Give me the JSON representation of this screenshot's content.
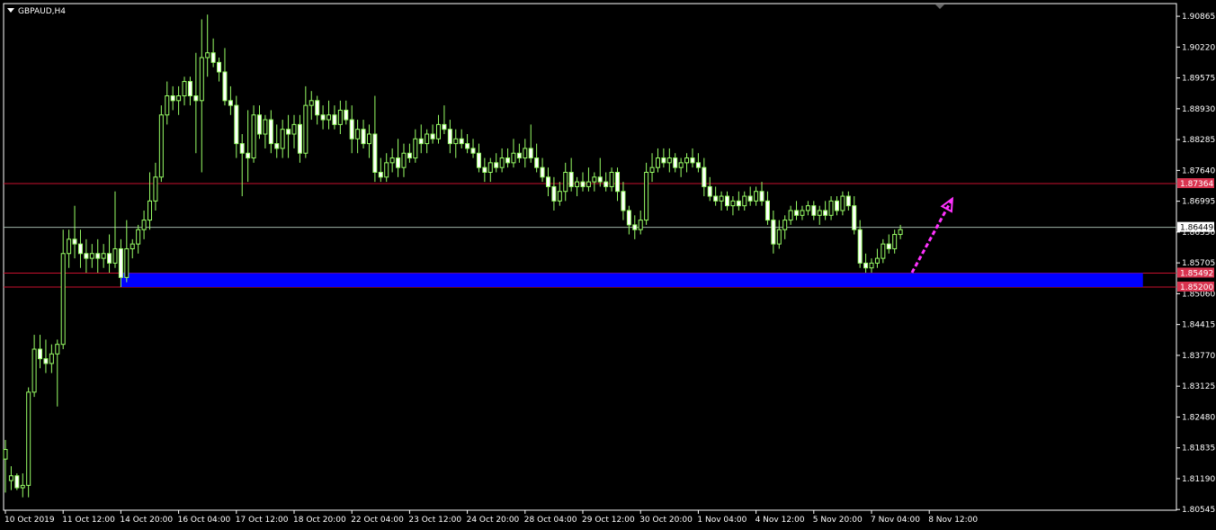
{
  "symbol_label": "GBPAUD,H4",
  "colors": {
    "background": "#000000",
    "frame": "#ffffff",
    "candle": "#99ff66",
    "candle_body_up": "#000000",
    "candle_body_down": "#ffffff",
    "resistance_line": "#c8102e",
    "current_price_line": "#a0b4a8",
    "support_zone": "#0000ff",
    "arrow": "#ff33ff",
    "label_red_bg": "#d9334f",
    "label_white_bg": "#ffffff"
  },
  "chart_data": {
    "type": "candlestick",
    "ylim": [
      1.8053,
      1.9113
    ],
    "y_ticks": [
      "1.90865",
      "1.90220",
      "1.89575",
      "1.88930",
      "1.88285",
      "1.87640",
      "1.86995",
      "1.86350",
      "1.85705",
      "1.85060",
      "1.84415",
      "1.83770",
      "1.83125",
      "1.82480",
      "1.81835",
      "1.81190",
      "1.80545"
    ],
    "x_ticks": [
      "10 Oct 2019",
      "11 Oct 12:00",
      "14 Oct 20:00",
      "16 Oct 04:00",
      "17 Oct 12:00",
      "18 Oct 20:00",
      "22 Oct 04:00",
      "23 Oct 12:00",
      "24 Oct 20:00",
      "28 Oct 04:00",
      "29 Oct 12:00",
      "30 Oct 20:00",
      "1 Nov 04:00",
      "4 Nov 12:00",
      "5 Nov 20:00",
      "7 Nov 04:00",
      "8 Nov 12:00"
    ],
    "x_tick_candle_index": [
      0,
      10,
      20,
      30,
      40,
      50,
      60,
      70,
      80,
      90,
      100,
      110,
      120,
      130,
      140,
      150,
      160
    ],
    "horizontal_lines": [
      {
        "label": "1.87364",
        "price": 1.87364,
        "style": "resistance"
      },
      {
        "label": "1.86449",
        "price": 1.86449,
        "style": "current"
      },
      {
        "label": "1.85492",
        "price": 1.85492,
        "style": "resistance"
      },
      {
        "label": "1.85200",
        "price": 1.852,
        "style": "resistance"
      }
    ],
    "support_zone": {
      "from_price": 1.85492,
      "to_price": 1.852,
      "from_candle": 20,
      "to_candle": 197
    },
    "arrow": {
      "from_candle": 157,
      "from_price": 1.855,
      "to_candle": 164,
      "to_price": 1.8705
    },
    "candles": [
      {
        "o": 1.816,
        "h": 1.82,
        "l": 1.809,
        "c": 1.818
      },
      {
        "o": 1.8115,
        "h": 1.8145,
        "l": 1.8095,
        "c": 1.8125
      },
      {
        "o": 1.8125,
        "h": 1.813,
        "l": 1.8095,
        "c": 1.81
      },
      {
        "o": 1.81,
        "h": 1.813,
        "l": 1.808,
        "c": 1.8105
      },
      {
        "o": 1.8105,
        "h": 1.831,
        "l": 1.808,
        "c": 1.83
      },
      {
        "o": 1.83,
        "h": 1.842,
        "l": 1.829,
        "c": 1.839
      },
      {
        "o": 1.839,
        "h": 1.842,
        "l": 1.835,
        "c": 1.837
      },
      {
        "o": 1.837,
        "h": 1.841,
        "l": 1.834,
        "c": 1.836
      },
      {
        "o": 1.836,
        "h": 1.84,
        "l": 1.834,
        "c": 1.838
      },
      {
        "o": 1.838,
        "h": 1.841,
        "l": 1.827,
        "c": 1.84
      },
      {
        "o": 1.84,
        "h": 1.864,
        "l": 1.839,
        "c": 1.859
      },
      {
        "o": 1.859,
        "h": 1.864,
        "l": 1.856,
        "c": 1.862
      },
      {
        "o": 1.862,
        "h": 1.869,
        "l": 1.858,
        "c": 1.861
      },
      {
        "o": 1.861,
        "h": 1.864,
        "l": 1.856,
        "c": 1.859
      },
      {
        "o": 1.859,
        "h": 1.862,
        "l": 1.855,
        "c": 1.858
      },
      {
        "o": 1.858,
        "h": 1.861,
        "l": 1.856,
        "c": 1.859
      },
      {
        "o": 1.859,
        "h": 1.862,
        "l": 1.855,
        "c": 1.858
      },
      {
        "o": 1.858,
        "h": 1.861,
        "l": 1.856,
        "c": 1.859
      },
      {
        "o": 1.859,
        "h": 1.863,
        "l": 1.855,
        "c": 1.857
      },
      {
        "o": 1.857,
        "h": 1.872,
        "l": 1.856,
        "c": 1.86
      },
      {
        "o": 1.86,
        "h": 1.862,
        "l": 1.852,
        "c": 1.854
      },
      {
        "o": 1.854,
        "h": 1.866,
        "l": 1.853,
        "c": 1.86
      },
      {
        "o": 1.86,
        "h": 1.862,
        "l": 1.858,
        "c": 1.861
      },
      {
        "o": 1.861,
        "h": 1.865,
        "l": 1.859,
        "c": 1.864
      },
      {
        "o": 1.864,
        "h": 1.868,
        "l": 1.862,
        "c": 1.866
      },
      {
        "o": 1.866,
        "h": 1.876,
        "l": 1.864,
        "c": 1.87
      },
      {
        "o": 1.87,
        "h": 1.878,
        "l": 1.868,
        "c": 1.875
      },
      {
        "o": 1.875,
        "h": 1.89,
        "l": 1.874,
        "c": 1.888
      },
      {
        "o": 1.888,
        "h": 1.895,
        "l": 1.886,
        "c": 1.892
      },
      {
        "o": 1.892,
        "h": 1.894,
        "l": 1.889,
        "c": 1.891
      },
      {
        "o": 1.891,
        "h": 1.894,
        "l": 1.888,
        "c": 1.892
      },
      {
        "o": 1.892,
        "h": 1.896,
        "l": 1.89,
        "c": 1.895
      },
      {
        "o": 1.895,
        "h": 1.896,
        "l": 1.89,
        "c": 1.892
      },
      {
        "o": 1.892,
        "h": 1.901,
        "l": 1.88,
        "c": 1.891
      },
      {
        "o": 1.891,
        "h": 1.908,
        "l": 1.876,
        "c": 1.9
      },
      {
        "o": 1.9,
        "h": 1.909,
        "l": 1.896,
        "c": 1.901
      },
      {
        "o": 1.901,
        "h": 1.904,
        "l": 1.898,
        "c": 1.899
      },
      {
        "o": 1.899,
        "h": 1.9,
        "l": 1.895,
        "c": 1.897
      },
      {
        "o": 1.897,
        "h": 1.902,
        "l": 1.89,
        "c": 1.891
      },
      {
        "o": 1.891,
        "h": 1.894,
        "l": 1.888,
        "c": 1.89
      },
      {
        "o": 1.89,
        "h": 1.892,
        "l": 1.879,
        "c": 1.882
      },
      {
        "o": 1.882,
        "h": 1.884,
        "l": 1.871,
        "c": 1.88
      },
      {
        "o": 1.88,
        "h": 1.889,
        "l": 1.874,
        "c": 1.879
      },
      {
        "o": 1.879,
        "h": 1.89,
        "l": 1.878,
        "c": 1.888
      },
      {
        "o": 1.888,
        "h": 1.89,
        "l": 1.883,
        "c": 1.884
      },
      {
        "o": 1.884,
        "h": 1.888,
        "l": 1.881,
        "c": 1.887
      },
      {
        "o": 1.887,
        "h": 1.889,
        "l": 1.88,
        "c": 1.882
      },
      {
        "o": 1.882,
        "h": 1.886,
        "l": 1.879,
        "c": 1.881
      },
      {
        "o": 1.881,
        "h": 1.887,
        "l": 1.879,
        "c": 1.885
      },
      {
        "o": 1.885,
        "h": 1.888,
        "l": 1.879,
        "c": 1.884
      },
      {
        "o": 1.884,
        "h": 1.888,
        "l": 1.881,
        "c": 1.886
      },
      {
        "o": 1.886,
        "h": 1.888,
        "l": 1.878,
        "c": 1.88
      },
      {
        "o": 1.88,
        "h": 1.894,
        "l": 1.879,
        "c": 1.89
      },
      {
        "o": 1.89,
        "h": 1.893,
        "l": 1.887,
        "c": 1.891
      },
      {
        "o": 1.891,
        "h": 1.892,
        "l": 1.886,
        "c": 1.888
      },
      {
        "o": 1.888,
        "h": 1.89,
        "l": 1.885,
        "c": 1.887
      },
      {
        "o": 1.887,
        "h": 1.891,
        "l": 1.885,
        "c": 1.888
      },
      {
        "o": 1.888,
        "h": 1.89,
        "l": 1.885,
        "c": 1.886
      },
      {
        "o": 1.886,
        "h": 1.891,
        "l": 1.884,
        "c": 1.889
      },
      {
        "o": 1.889,
        "h": 1.891,
        "l": 1.886,
        "c": 1.887
      },
      {
        "o": 1.887,
        "h": 1.89,
        "l": 1.88,
        "c": 1.883
      },
      {
        "o": 1.883,
        "h": 1.887,
        "l": 1.88,
        "c": 1.885
      },
      {
        "o": 1.885,
        "h": 1.887,
        "l": 1.881,
        "c": 1.882
      },
      {
        "o": 1.882,
        "h": 1.886,
        "l": 1.879,
        "c": 1.884
      },
      {
        "o": 1.884,
        "h": 1.892,
        "l": 1.874,
        "c": 1.876
      },
      {
        "o": 1.876,
        "h": 1.879,
        "l": 1.874,
        "c": 1.875
      },
      {
        "o": 1.875,
        "h": 1.88,
        "l": 1.874,
        "c": 1.878
      },
      {
        "o": 1.878,
        "h": 1.881,
        "l": 1.876,
        "c": 1.879
      },
      {
        "o": 1.879,
        "h": 1.883,
        "l": 1.875,
        "c": 1.877
      },
      {
        "o": 1.877,
        "h": 1.882,
        "l": 1.875,
        "c": 1.88
      },
      {
        "o": 1.88,
        "h": 1.882,
        "l": 1.878,
        "c": 1.879
      },
      {
        "o": 1.879,
        "h": 1.885,
        "l": 1.878,
        "c": 1.883
      },
      {
        "o": 1.883,
        "h": 1.886,
        "l": 1.88,
        "c": 1.882
      },
      {
        "o": 1.882,
        "h": 1.885,
        "l": 1.88,
        "c": 1.884
      },
      {
        "o": 1.884,
        "h": 1.886,
        "l": 1.882,
        "c": 1.883
      },
      {
        "o": 1.883,
        "h": 1.888,
        "l": 1.882,
        "c": 1.886
      },
      {
        "o": 1.886,
        "h": 1.89,
        "l": 1.884,
        "c": 1.885
      },
      {
        "o": 1.885,
        "h": 1.887,
        "l": 1.88,
        "c": 1.882
      },
      {
        "o": 1.882,
        "h": 1.885,
        "l": 1.879,
        "c": 1.883
      },
      {
        "o": 1.883,
        "h": 1.885,
        "l": 1.881,
        "c": 1.882
      },
      {
        "o": 1.882,
        "h": 1.884,
        "l": 1.88,
        "c": 1.881
      },
      {
        "o": 1.881,
        "h": 1.883,
        "l": 1.879,
        "c": 1.88
      },
      {
        "o": 1.88,
        "h": 1.882,
        "l": 1.876,
        "c": 1.877
      },
      {
        "o": 1.877,
        "h": 1.879,
        "l": 1.874,
        "c": 1.876
      },
      {
        "o": 1.876,
        "h": 1.879,
        "l": 1.874,
        "c": 1.878
      },
      {
        "o": 1.878,
        "h": 1.88,
        "l": 1.876,
        "c": 1.877
      },
      {
        "o": 1.877,
        "h": 1.881,
        "l": 1.876,
        "c": 1.879
      },
      {
        "o": 1.879,
        "h": 1.881,
        "l": 1.877,
        "c": 1.878
      },
      {
        "o": 1.878,
        "h": 1.883,
        "l": 1.877,
        "c": 1.88
      },
      {
        "o": 1.88,
        "h": 1.882,
        "l": 1.878,
        "c": 1.879
      },
      {
        "o": 1.879,
        "h": 1.883,
        "l": 1.877,
        "c": 1.881
      },
      {
        "o": 1.881,
        "h": 1.886,
        "l": 1.878,
        "c": 1.879
      },
      {
        "o": 1.879,
        "h": 1.882,
        "l": 1.876,
        "c": 1.877
      },
      {
        "o": 1.877,
        "h": 1.879,
        "l": 1.874,
        "c": 1.875
      },
      {
        "o": 1.875,
        "h": 1.877,
        "l": 1.871,
        "c": 1.873
      },
      {
        "o": 1.873,
        "h": 1.875,
        "l": 1.868,
        "c": 1.87
      },
      {
        "o": 1.87,
        "h": 1.874,
        "l": 1.869,
        "c": 1.872
      },
      {
        "o": 1.872,
        "h": 1.878,
        "l": 1.87,
        "c": 1.876
      },
      {
        "o": 1.876,
        "h": 1.879,
        "l": 1.872,
        "c": 1.873
      },
      {
        "o": 1.873,
        "h": 1.875,
        "l": 1.871,
        "c": 1.874
      },
      {
        "o": 1.874,
        "h": 1.876,
        "l": 1.872,
        "c": 1.873
      },
      {
        "o": 1.873,
        "h": 1.877,
        "l": 1.872,
        "c": 1.874
      },
      {
        "o": 1.874,
        "h": 1.876,
        "l": 1.872,
        "c": 1.875
      },
      {
        "o": 1.875,
        "h": 1.879,
        "l": 1.873,
        "c": 1.874
      },
      {
        "o": 1.874,
        "h": 1.876,
        "l": 1.872,
        "c": 1.873
      },
      {
        "o": 1.873,
        "h": 1.877,
        "l": 1.872,
        "c": 1.876
      },
      {
        "o": 1.876,
        "h": 1.877,
        "l": 1.87,
        "c": 1.872
      },
      {
        "o": 1.872,
        "h": 1.874,
        "l": 1.866,
        "c": 1.868
      },
      {
        "o": 1.868,
        "h": 1.869,
        "l": 1.863,
        "c": 1.865
      },
      {
        "o": 1.865,
        "h": 1.867,
        "l": 1.862,
        "c": 1.864
      },
      {
        "o": 1.864,
        "h": 1.868,
        "l": 1.863,
        "c": 1.866
      },
      {
        "o": 1.866,
        "h": 1.878,
        "l": 1.865,
        "c": 1.876
      },
      {
        "o": 1.876,
        "h": 1.88,
        "l": 1.874,
        "c": 1.877
      },
      {
        "o": 1.877,
        "h": 1.881,
        "l": 1.876,
        "c": 1.879
      },
      {
        "o": 1.879,
        "h": 1.881,
        "l": 1.877,
        "c": 1.878
      },
      {
        "o": 1.878,
        "h": 1.881,
        "l": 1.876,
        "c": 1.879
      },
      {
        "o": 1.879,
        "h": 1.88,
        "l": 1.876,
        "c": 1.877
      },
      {
        "o": 1.877,
        "h": 1.879,
        "l": 1.875,
        "c": 1.878
      },
      {
        "o": 1.878,
        "h": 1.88,
        "l": 1.876,
        "c": 1.879
      },
      {
        "o": 1.879,
        "h": 1.881,
        "l": 1.877,
        "c": 1.878
      },
      {
        "o": 1.878,
        "h": 1.88,
        "l": 1.876,
        "c": 1.877
      },
      {
        "o": 1.877,
        "h": 1.879,
        "l": 1.871,
        "c": 1.873
      },
      {
        "o": 1.873,
        "h": 1.875,
        "l": 1.87,
        "c": 1.871
      },
      {
        "o": 1.871,
        "h": 1.873,
        "l": 1.869,
        "c": 1.87
      },
      {
        "o": 1.87,
        "h": 1.872,
        "l": 1.868,
        "c": 1.871
      },
      {
        "o": 1.871,
        "h": 1.872,
        "l": 1.868,
        "c": 1.869
      },
      {
        "o": 1.869,
        "h": 1.871,
        "l": 1.867,
        "c": 1.87
      },
      {
        "o": 1.87,
        "h": 1.872,
        "l": 1.868,
        "c": 1.869
      },
      {
        "o": 1.869,
        "h": 1.872,
        "l": 1.868,
        "c": 1.871
      },
      {
        "o": 1.871,
        "h": 1.873,
        "l": 1.869,
        "c": 1.87
      },
      {
        "o": 1.87,
        "h": 1.873,
        "l": 1.869,
        "c": 1.872
      },
      {
        "o": 1.872,
        "h": 1.874,
        "l": 1.869,
        "c": 1.87
      },
      {
        "o": 1.87,
        "h": 1.872,
        "l": 1.865,
        "c": 1.866
      },
      {
        "o": 1.866,
        "h": 1.868,
        "l": 1.859,
        "c": 1.861
      },
      {
        "o": 1.861,
        "h": 1.866,
        "l": 1.86,
        "c": 1.864
      },
      {
        "o": 1.864,
        "h": 1.867,
        "l": 1.862,
        "c": 1.866
      },
      {
        "o": 1.866,
        "h": 1.869,
        "l": 1.865,
        "c": 1.868
      },
      {
        "o": 1.868,
        "h": 1.87,
        "l": 1.866,
        "c": 1.867
      },
      {
        "o": 1.867,
        "h": 1.869,
        "l": 1.866,
        "c": 1.868
      },
      {
        "o": 1.868,
        "h": 1.87,
        "l": 1.867,
        "c": 1.869
      },
      {
        "o": 1.869,
        "h": 1.87,
        "l": 1.866,
        "c": 1.867
      },
      {
        "o": 1.867,
        "h": 1.869,
        "l": 1.865,
        "c": 1.868
      },
      {
        "o": 1.868,
        "h": 1.87,
        "l": 1.866,
        "c": 1.867
      },
      {
        "o": 1.867,
        "h": 1.871,
        "l": 1.866,
        "c": 1.87
      },
      {
        "o": 1.87,
        "h": 1.871,
        "l": 1.867,
        "c": 1.868
      },
      {
        "o": 1.868,
        "h": 1.872,
        "l": 1.867,
        "c": 1.871
      },
      {
        "o": 1.871,
        "h": 1.872,
        "l": 1.868,
        "c": 1.869
      },
      {
        "o": 1.869,
        "h": 1.871,
        "l": 1.863,
        "c": 1.864
      },
      {
        "o": 1.864,
        "h": 1.866,
        "l": 1.856,
        "c": 1.857
      },
      {
        "o": 1.857,
        "h": 1.859,
        "l": 1.855,
        "c": 1.856
      },
      {
        "o": 1.856,
        "h": 1.858,
        "l": 1.855,
        "c": 1.857
      },
      {
        "o": 1.857,
        "h": 1.86,
        "l": 1.856,
        "c": 1.858
      },
      {
        "o": 1.858,
        "h": 1.862,
        "l": 1.857,
        "c": 1.861
      },
      {
        "o": 1.861,
        "h": 1.863,
        "l": 1.859,
        "c": 1.86
      },
      {
        "o": 1.86,
        "h": 1.864,
        "l": 1.859,
        "c": 1.863
      },
      {
        "o": 1.863,
        "h": 1.865,
        "l": 1.862,
        "c": 1.864
      }
    ]
  }
}
